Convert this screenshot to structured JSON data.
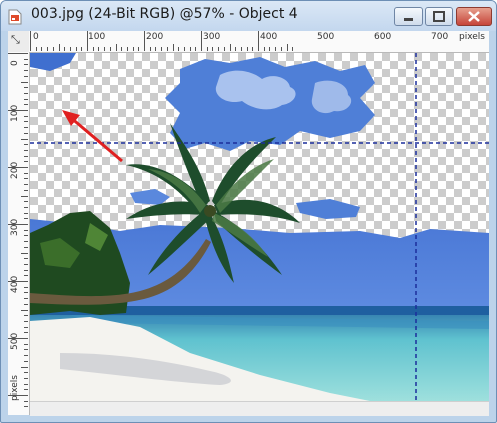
{
  "window": {
    "title": "003.jpg (24-Bit RGB) @57% - Object 4"
  },
  "icons": {
    "app": "image-document-icon",
    "minimize": "minimize-icon",
    "maximize": "maximize-icon",
    "close": "close-icon",
    "ruler_corner": "ruler-origin-icon"
  },
  "controls": {
    "minimize_glyph": "▁",
    "maximize_glyph": "▢",
    "close_glyph": "✕"
  },
  "rulers": {
    "horizontal_labels": [
      "0",
      "100",
      "200",
      "300",
      "400",
      "500",
      "600",
      "700"
    ],
    "horizontal_unit": "pixels",
    "vertical_labels": [
      "0",
      "100",
      "200",
      "300",
      "400",
      "500"
    ],
    "vertical_unit": "pixels",
    "corner_glyph": "⤡"
  },
  "colors": {
    "guide": "#1c2f9c",
    "arrow": "#e02020",
    "sky": "#4d7fd8",
    "sea": "#7fd0d8",
    "sand": "#f4f3ef"
  }
}
